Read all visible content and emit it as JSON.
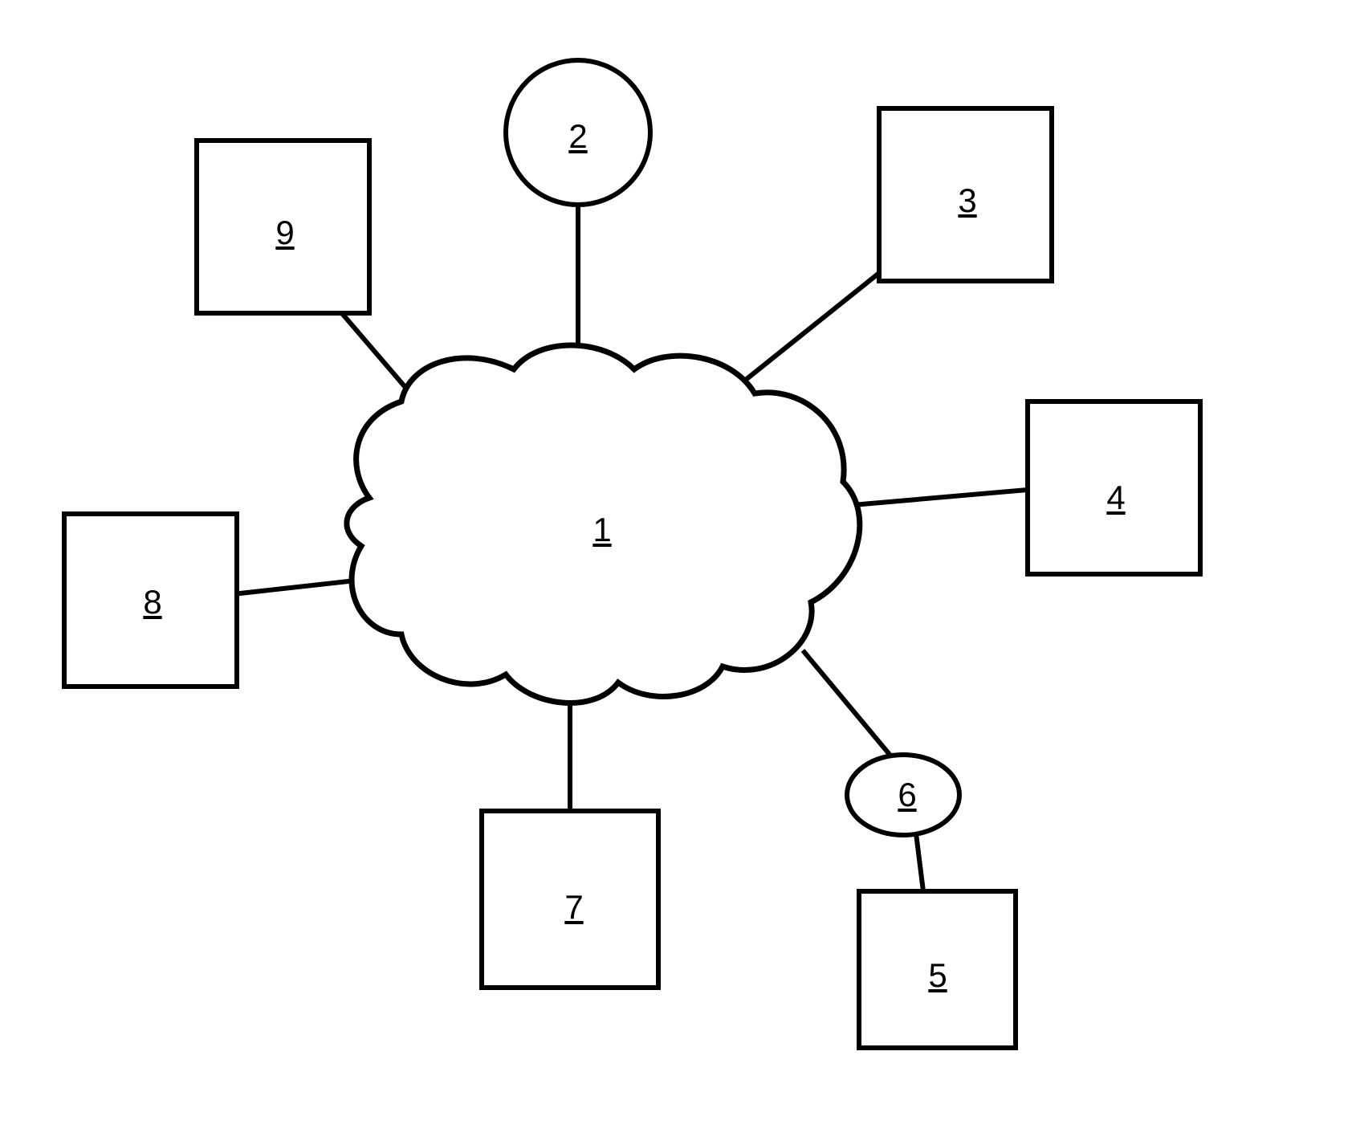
{
  "diagram": {
    "nodes": {
      "cloud": {
        "label": "1"
      },
      "circle_top": {
        "label": "2"
      },
      "box_top_right": {
        "label": "3"
      },
      "box_right": {
        "label": "4"
      },
      "box_bottom_right": {
        "label": "5"
      },
      "oval_small": {
        "label": "6"
      },
      "box_bottom": {
        "label": "7"
      },
      "box_left": {
        "label": "8"
      },
      "box_top_left": {
        "label": "9"
      }
    }
  }
}
